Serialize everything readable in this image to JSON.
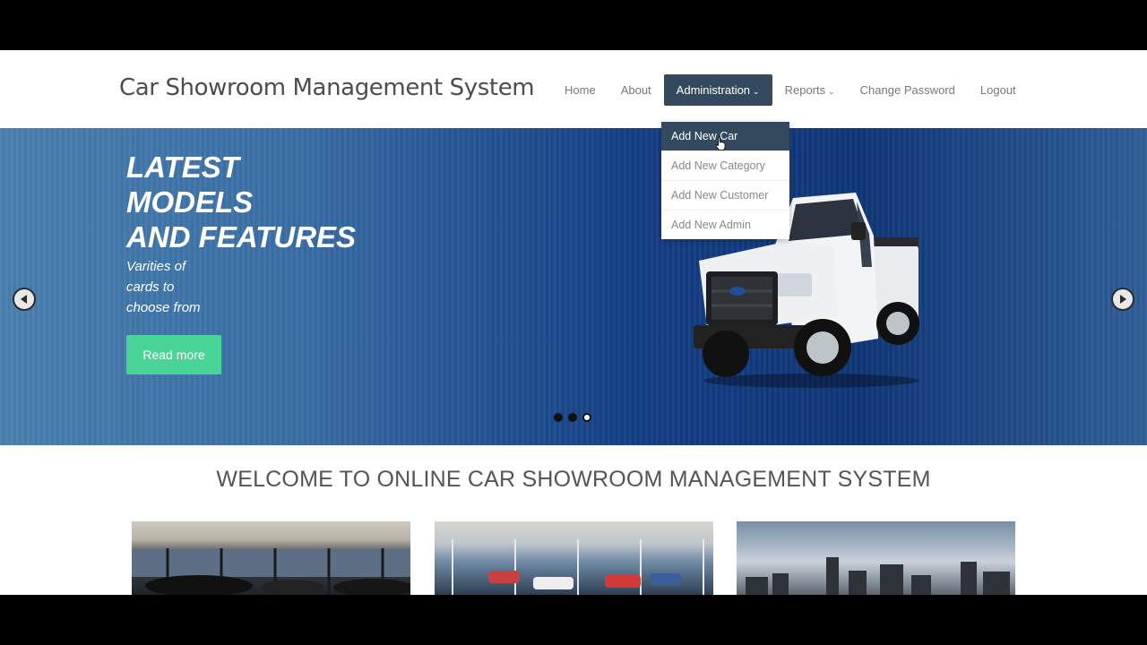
{
  "header": {
    "brand": "Car Showroom Management System",
    "nav": [
      {
        "label": "Home"
      },
      {
        "label": "About"
      },
      {
        "label": "Administration",
        "active": true
      },
      {
        "label": "Reports"
      },
      {
        "label": "Change Password"
      },
      {
        "label": "Logout"
      }
    ]
  },
  "dropdown": {
    "items": [
      {
        "label": "Add New Car",
        "active": true
      },
      {
        "label": "Add New Category"
      },
      {
        "label": "Add New Customer"
      },
      {
        "label": "Add New Admin"
      }
    ]
  },
  "hero": {
    "title_lines": [
      "LATEST",
      "MODELS",
      "AND FEATURES"
    ],
    "subtitle_lines": [
      "Varities of",
      "cards to",
      "choose from"
    ],
    "read_more": "Read more",
    "slides_active_index": 2
  },
  "welcome": {
    "title": "WELCOME TO ONLINE CAR SHOWROOM MANAGEMENT SYSTEM"
  },
  "colors": {
    "nav_active": "#34495e",
    "button_green": "#48d597",
    "hero_blue": "#143f86"
  }
}
